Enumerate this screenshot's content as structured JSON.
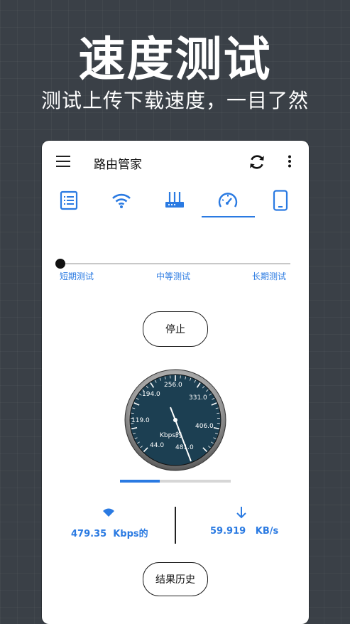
{
  "hero": {
    "title": "速度测试",
    "subtitle": "测试上传下载速度，一目了然"
  },
  "app": {
    "title": "路由管家",
    "icons": [
      "menu-icon",
      "refresh-icon",
      "more-vertical-icon"
    ]
  },
  "tabs": [
    {
      "icon": "list-icon",
      "selected": false
    },
    {
      "icon": "wifi-icon",
      "selected": false
    },
    {
      "icon": "router-icon",
      "selected": false
    },
    {
      "icon": "speedometer-icon",
      "selected": true
    },
    {
      "icon": "phone-device-icon",
      "selected": false
    }
  ],
  "test_duration": {
    "options": [
      "短期测试",
      "中等测试",
      "长期测试"
    ],
    "selected": "短期测试"
  },
  "stop_label": "停止",
  "gauge": {
    "unit_label": "Kbps的",
    "scale_labels": [
      "44.0",
      "119.0",
      "194.0",
      "256.0",
      "331.0",
      "406.0",
      "481.0"
    ]
  },
  "progress": {
    "fraction": 0.36
  },
  "stats": {
    "upload_value": "479.35",
    "upload_unit": "Kbps的",
    "download_value": "59.919",
    "download_unit": "KB/s"
  },
  "history_label": "结果历史",
  "colors": {
    "accent": "#2a7ae2",
    "gauge_face": "#1c3f52",
    "background": "#3a4047"
  }
}
